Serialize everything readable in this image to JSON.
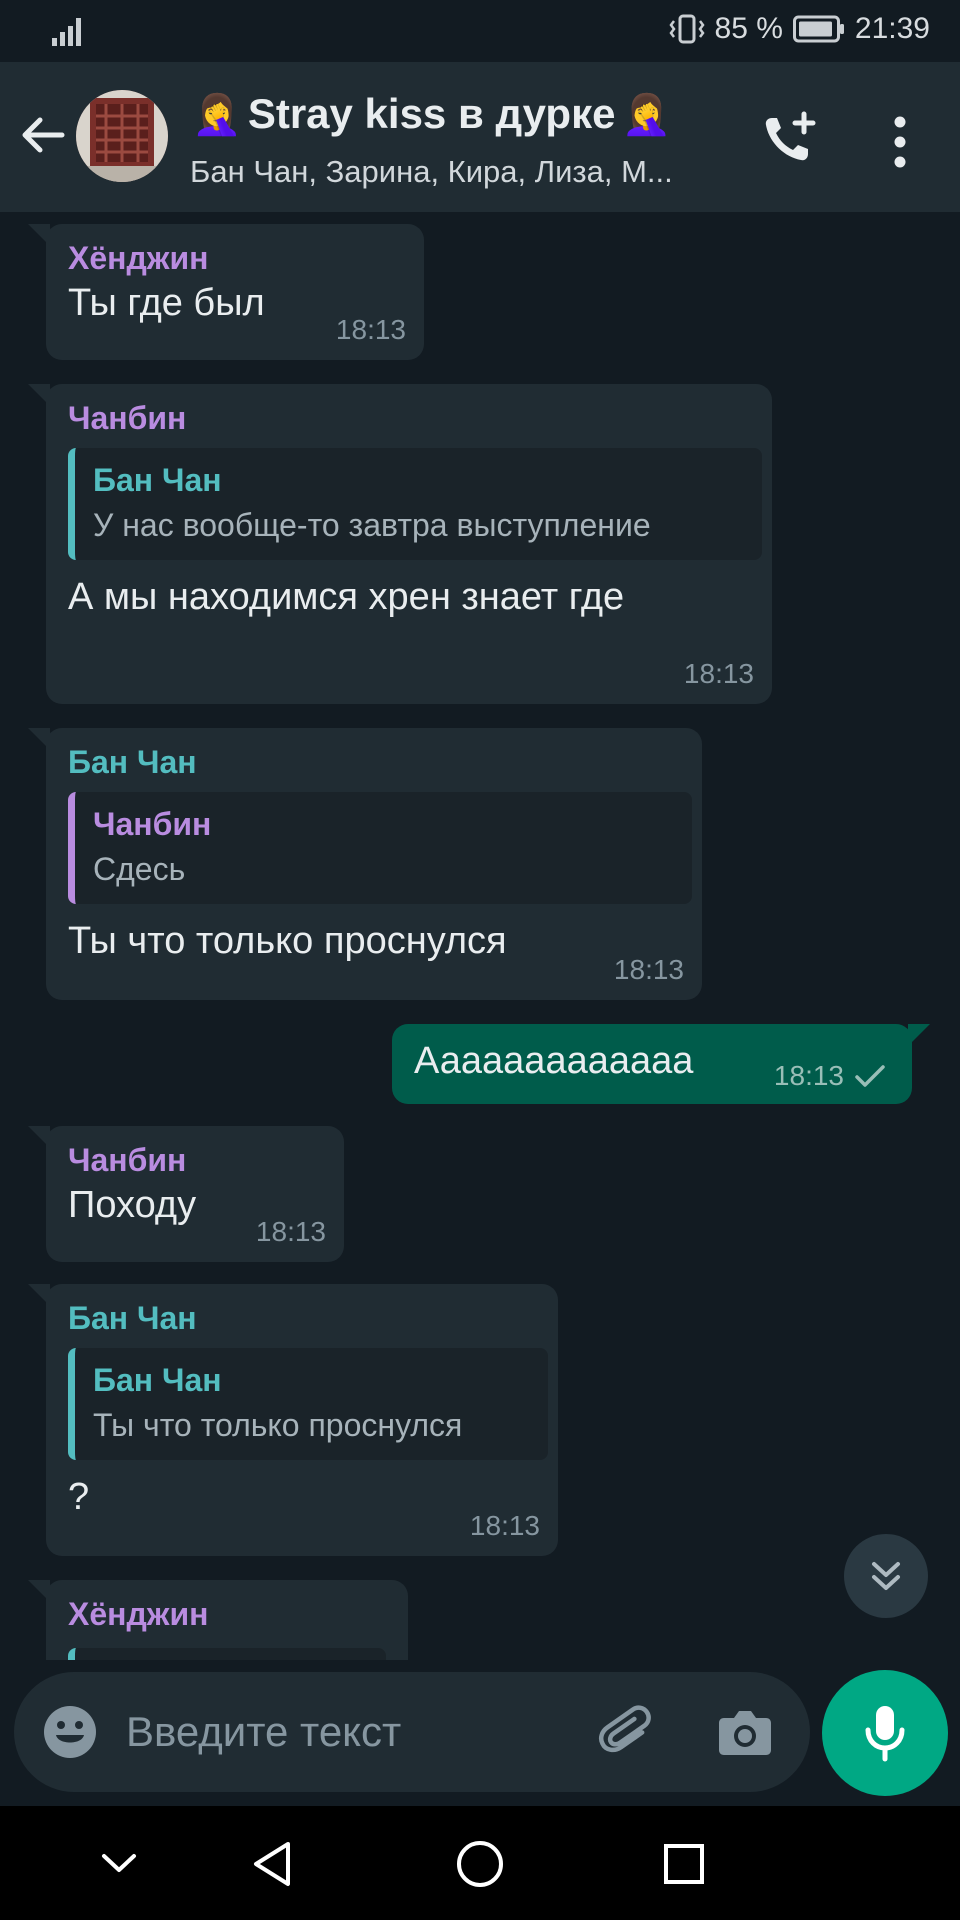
{
  "status_bar": {
    "battery": "85 %",
    "time": "21:39"
  },
  "header": {
    "emoji_left": "🤦‍♀️",
    "title": "Stray kiss в дурке",
    "emoji_right": "🤦‍♀️",
    "participants": "Бан Чан, Зарина, Кира, Лиза, М..."
  },
  "messages": [
    {
      "sender": "Хёнджин",
      "sender_color": "#b98ce0",
      "text": "Ты где был",
      "time": "18:13"
    },
    {
      "sender": "Чанбин",
      "sender_color": "#b98ce0",
      "quote": {
        "name": "Бан Чан",
        "text": "У нас вообще-то завтра выступление"
      },
      "text": "А мы находимся хрен знает где",
      "time": "18:13"
    },
    {
      "sender": "Бан Чан",
      "sender_color": "#53bdc0",
      "quote": {
        "name": "Чанбин",
        "text": "Сдесь"
      },
      "text": "Ты что только проснулся",
      "time": "18:13"
    },
    {
      "outgoing": true,
      "text": "Ааааааааааааа",
      "time": "18:13",
      "status": "sent"
    },
    {
      "sender": "Чанбин",
      "sender_color": "#b98ce0",
      "text": "Походу",
      "time": "18:13"
    },
    {
      "sender": "Бан Чан",
      "sender_color": "#53bdc0",
      "quote": {
        "name": "Бан Чан",
        "text": "Ты что только проснулся"
      },
      "text": "?",
      "time": "18:13"
    },
    {
      "sender": "Хёнджин",
      "sender_color": "#b98ce0"
    }
  ],
  "composer": {
    "placeholder": "Введите текст"
  },
  "colors": {
    "accent": "#00a884",
    "outgoing_bubble": "#005c4b",
    "incoming_bubble": "#202c33",
    "background": "#121b22"
  }
}
